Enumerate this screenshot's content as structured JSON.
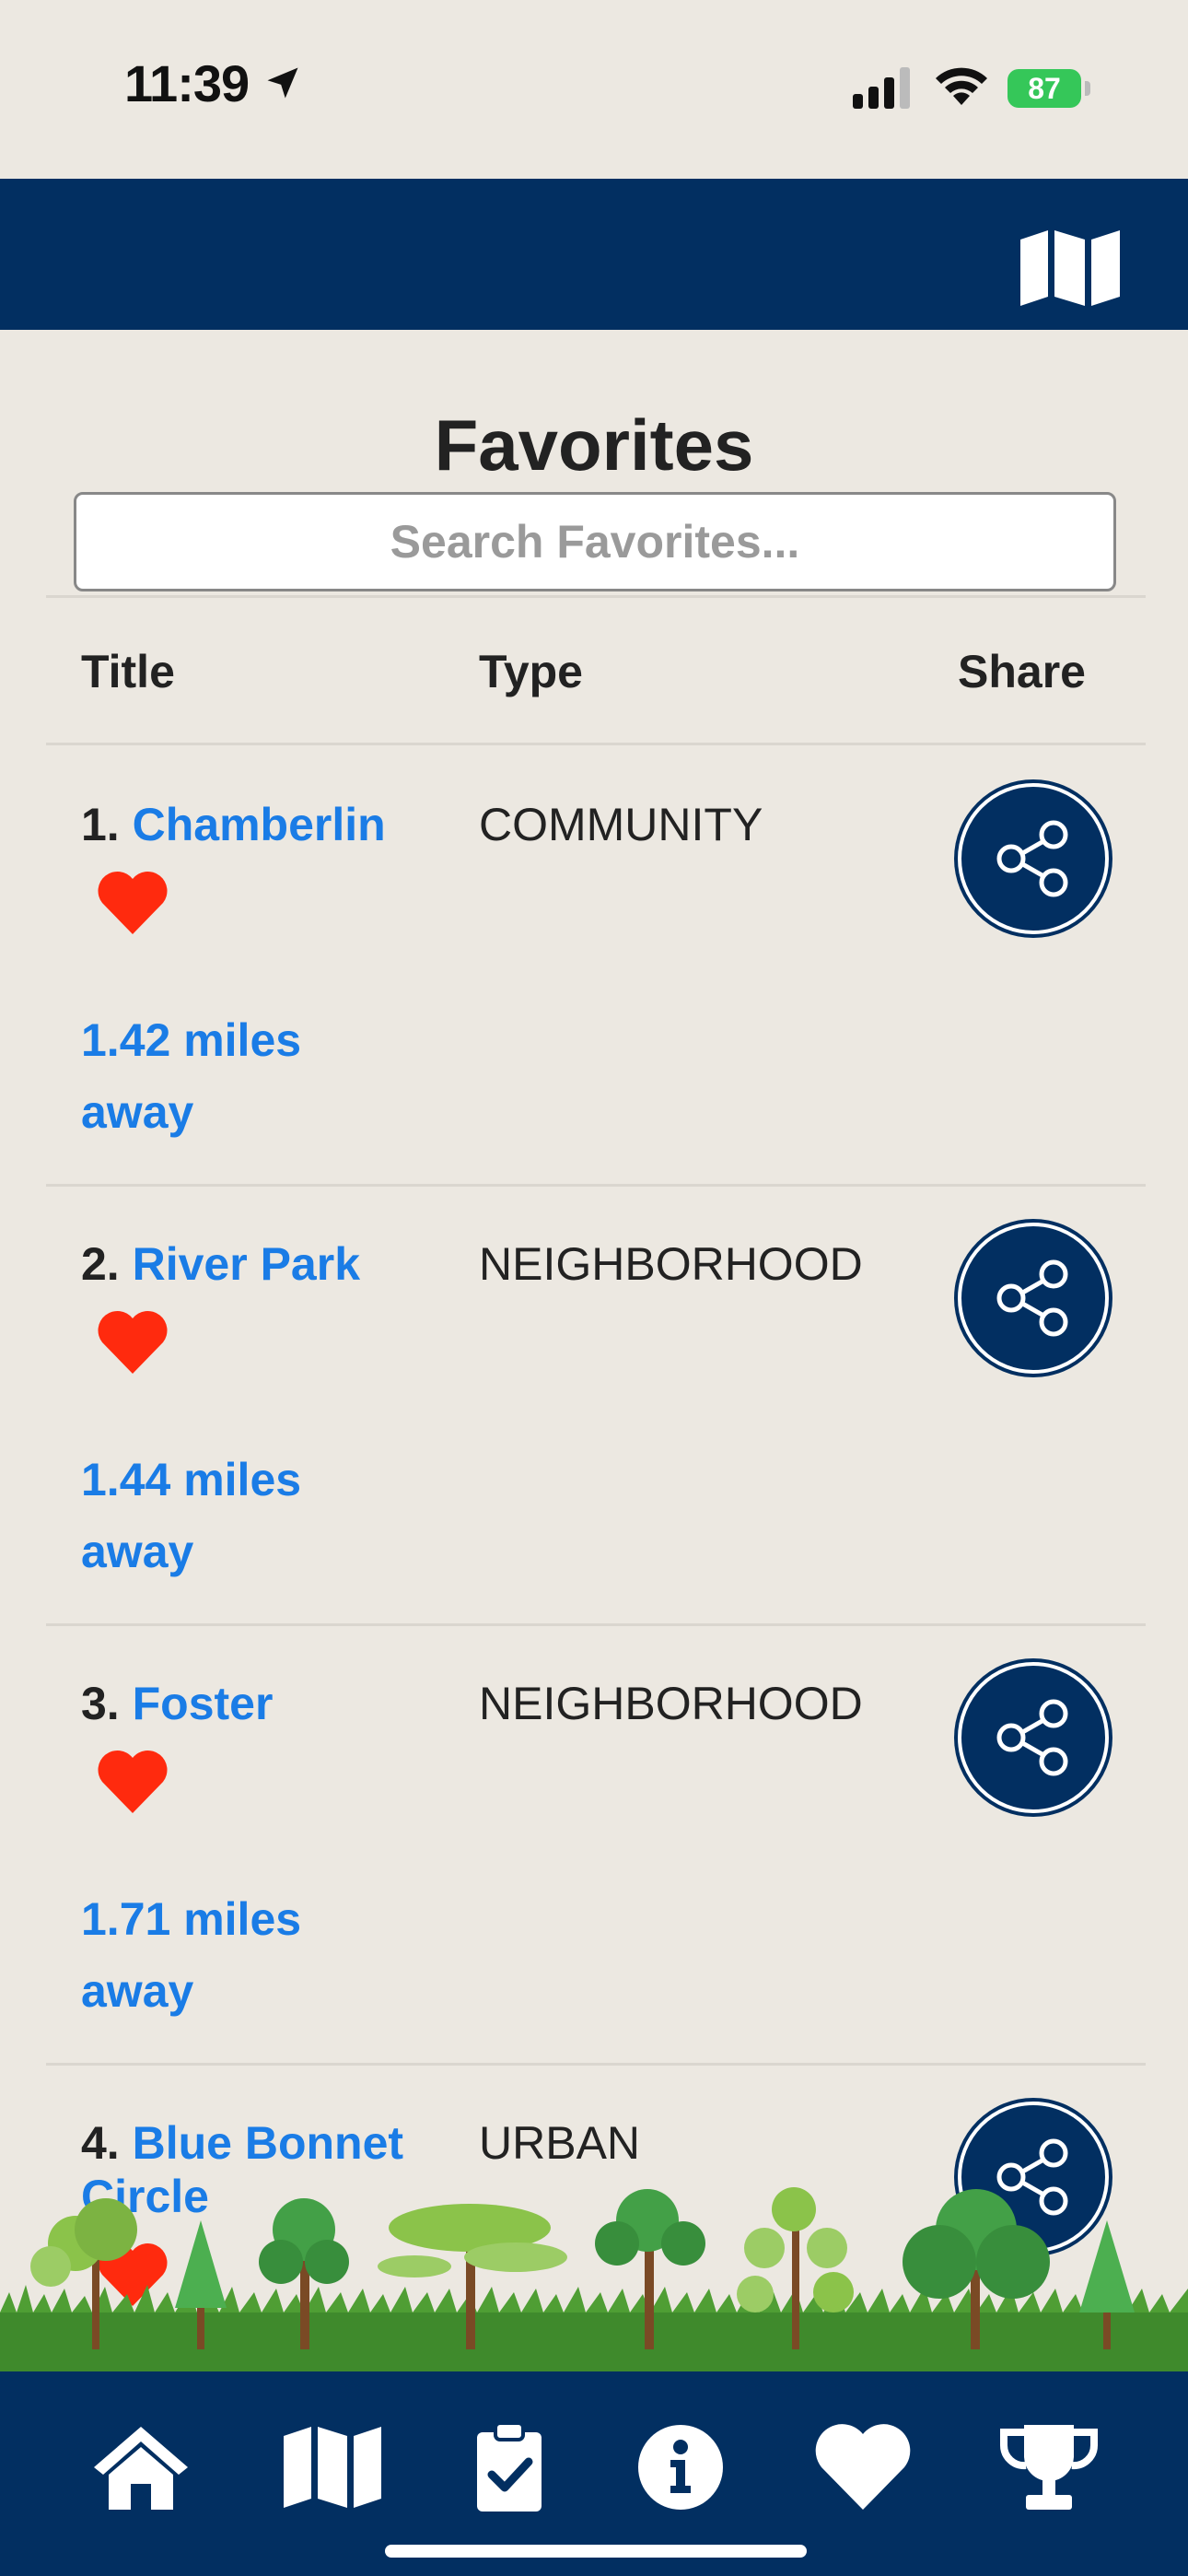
{
  "status_bar": {
    "time": "11:39",
    "battery": "87"
  },
  "page": {
    "title": "Favorites",
    "search_placeholder": "Search Favorites..."
  },
  "table": {
    "headers": {
      "title": "Title",
      "type": "Type",
      "share": "Share"
    },
    "rows": [
      {
        "num": "1.",
        "name": "Chamberlin",
        "type": "COMMUNITY",
        "distance": "1.42 miles away"
      },
      {
        "num": "2.",
        "name": "River Park",
        "type": "NEIGHBORHOOD",
        "distance": "1.44 miles away"
      },
      {
        "num": "3.",
        "name": "Foster",
        "type": "NEIGHBORHOOD",
        "distance": "1.71 miles away"
      },
      {
        "num": "4.",
        "name": "Blue Bonnet Circle",
        "type": "URBAN",
        "distance": ""
      }
    ]
  },
  "bottom_nav": {
    "items": [
      "home-icon",
      "map-icon",
      "clipboard-check-icon",
      "info-icon",
      "heart-icon",
      "trophy-icon"
    ]
  },
  "colors": {
    "navy": "#022f61",
    "link_blue": "#1a7ce6",
    "heart_red": "#ff2a0e",
    "background": "#ece8e1"
  }
}
